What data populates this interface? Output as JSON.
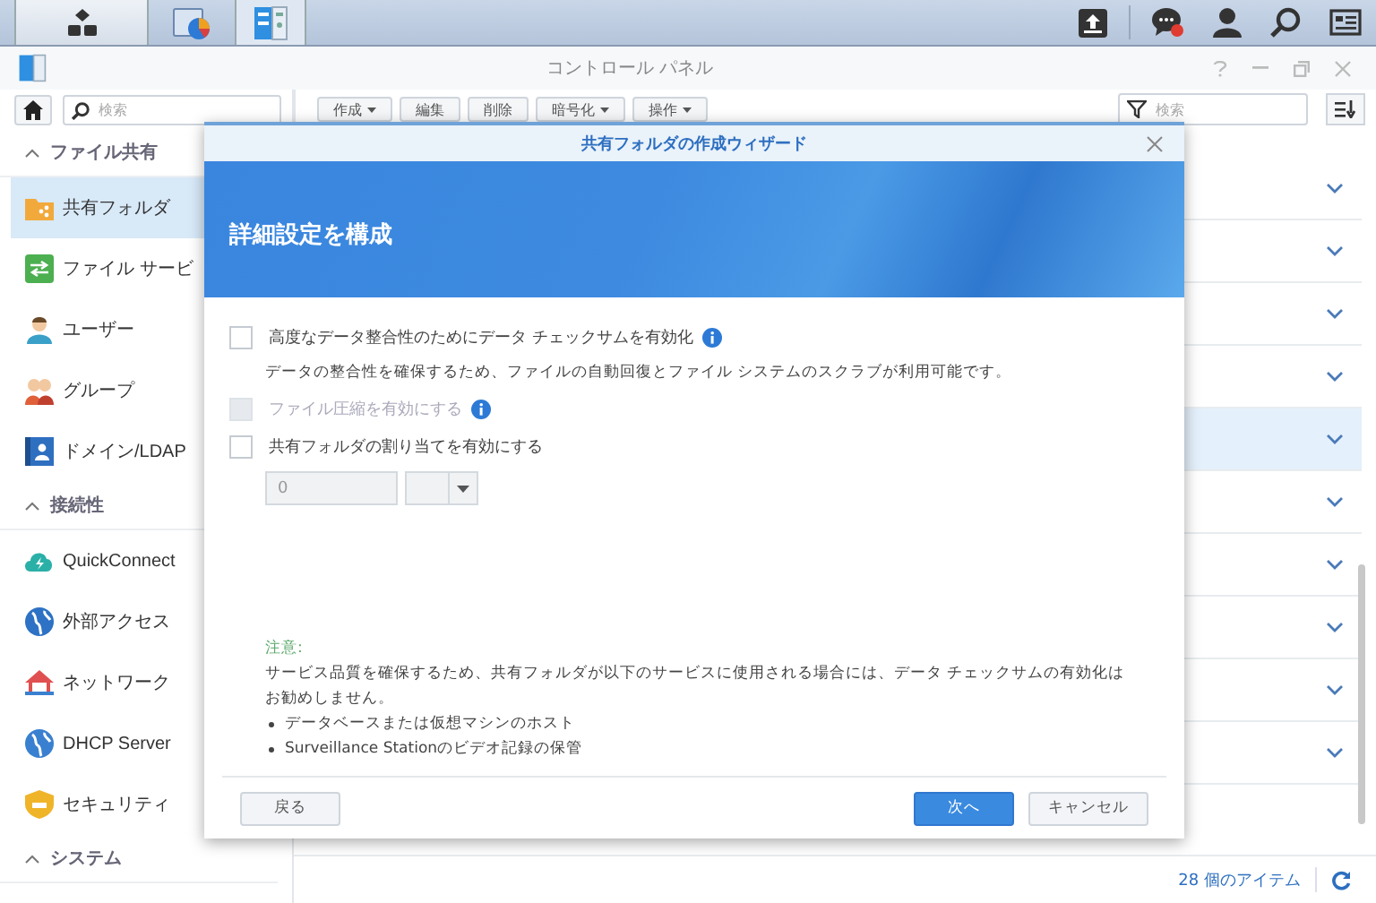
{
  "taskbar": {
    "apps": [
      {
        "kind": "storage",
        "selected": false
      },
      {
        "kind": "panel",
        "selected": true
      }
    ]
  },
  "window": {
    "title": "コントロール パネル"
  },
  "sidebar": {
    "search": {
      "placeholder": "検索"
    },
    "sections": [
      {
        "title": "ファイル共有",
        "expanded": true,
        "items": [
          {
            "label": "共有フォルダ",
            "selected": true
          },
          {
            "label": "ファイル サービ",
            "selected": false
          },
          {
            "label": "ユーザー",
            "selected": false
          },
          {
            "label": "グループ",
            "selected": false
          },
          {
            "label": "ドメイン/LDAP",
            "selected": false
          }
        ]
      },
      {
        "title": "接続性",
        "expanded": true,
        "items": [
          {
            "label": "QuickConnect",
            "selected": false
          },
          {
            "label": "外部アクセス",
            "selected": false
          },
          {
            "label": "ネットワーク",
            "selected": false
          },
          {
            "label": "DHCP Server",
            "selected": false
          },
          {
            "label": "セキュリティ",
            "selected": false
          }
        ]
      },
      {
        "title": "システム",
        "expanded": true
      }
    ]
  },
  "toolbar": {
    "buttons": [
      {
        "label": "作成",
        "dropdown": true
      },
      {
        "label": "編集",
        "dropdown": false
      },
      {
        "label": "削除",
        "dropdown": false
      },
      {
        "label": "暗号化",
        "dropdown": true
      },
      {
        "label": "操作",
        "dropdown": true
      }
    ],
    "filter": {
      "placeholder": "検索"
    }
  },
  "list": {
    "rows": [
      {
        "selected": false
      },
      {
        "selected": false
      },
      {
        "selected": false
      },
      {
        "selected": false
      },
      {
        "selected": true
      },
      {
        "selected": false
      },
      {
        "selected": false
      },
      {
        "selected": false
      },
      {
        "selected": false
      },
      {
        "selected": false
      }
    ]
  },
  "status_bar": {
    "count": "28 個のアイテム"
  },
  "dialog": {
    "title": "共有フォルダの作成ウィザード",
    "heading": "詳細設定を構成",
    "options": [
      {
        "kind": "checkbox",
        "label": "高度なデータ整合性のためにデータ チェックサムを有効化",
        "checked": false,
        "disabled": false,
        "info": true
      },
      {
        "kind": "description",
        "text": "データの整合性を確保するため、ファイルの自動回復とファイル システムのスクラブが利用可能です。"
      },
      {
        "kind": "checkbox",
        "label": "ファイル圧縮を有効にする",
        "checked": false,
        "disabled": true,
        "info": true
      },
      {
        "kind": "checkbox",
        "label": "共有フォルダの割り当てを有効にする",
        "checked": false,
        "disabled": false,
        "info": false
      },
      {
        "kind": "quota",
        "value": "0",
        "disabled": true
      }
    ],
    "note": {
      "title": "注意:",
      "text": "サービス品質を確保するため、共有フォルダが以下のサービスに使用される場合には、データ チェックサムの有効化はお勧めしません。",
      "bullets": [
        "データベースまたは仮想マシンのホスト",
        "Surveillance Stationのビデオ記録の保管"
      ]
    },
    "buttons": [
      {
        "label": "戻る",
        "kind": "back"
      },
      {
        "label": "次へ",
        "kind": "primary"
      },
      {
        "label": "キャンセル",
        "kind": "secondary"
      }
    ]
  }
}
